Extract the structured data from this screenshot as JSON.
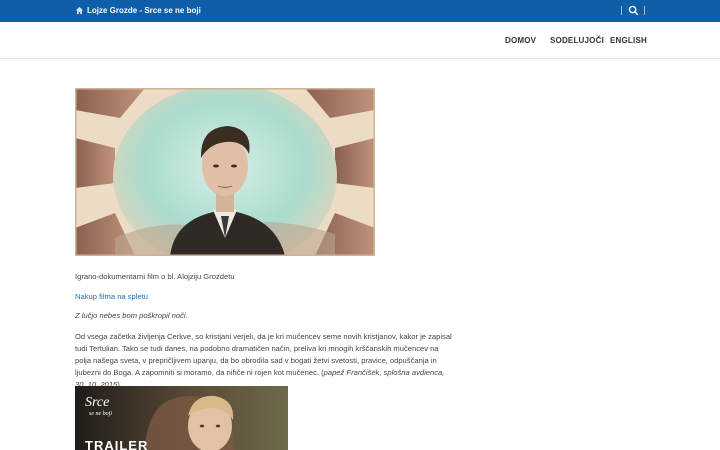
{
  "topbar": {
    "title": "Lojze Grozde - Srce se ne boji",
    "icons": {
      "home": "home-icon",
      "search": "search-icon"
    },
    "color": "#0e5ea8"
  },
  "nav": {
    "items": [
      {
        "label": "DOMOV"
      },
      {
        "label": "SODELUJOČI"
      },
      {
        "label": "ENGLISH"
      }
    ]
  },
  "main": {
    "subtitle": "Igrano-dokumentarni film o bl. Alojziju Grozdetu",
    "buy_link": "Nakup filma na spletu",
    "quote": "Z lučjo nebes bom poškropil noči.",
    "paragraph_text": "Od vsega začetka življenja Cerkve, so kristjani verjeli, da je kri mučencev seme novih kristjanov, kakor je zapisal tudi Tertulian. Tako se tudi danes, na podobno dramatičen način, preliva kri mnogih krščanskih mučencev na polja našega sveta, v prepričljivem upanju, da bo obrodila sad v bogati žetvi svetosti, pravice, odpuščanja in ljubezni do Boga. A zapomniti si moramo, da nihče ni rojen kot mučenec.",
    "paragraph_cite": "papež Frančišek, splošna avdienca, 30. 10. 2015",
    "trailer": {
      "logo_line1": "Srce",
      "logo_line2": "se ne boji",
      "label": "TRAILER"
    }
  }
}
